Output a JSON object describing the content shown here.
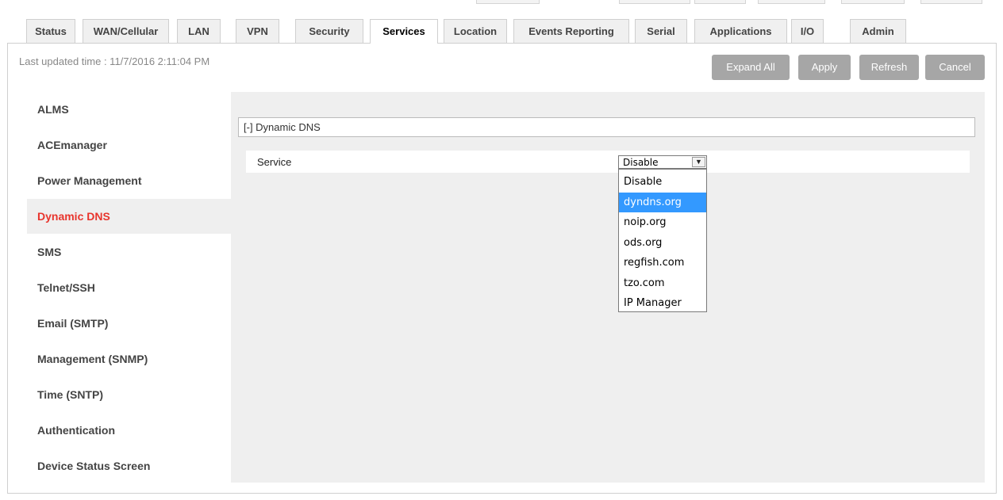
{
  "tabs": [
    {
      "label": "Status"
    },
    {
      "label": "WAN/Cellular"
    },
    {
      "label": "LAN"
    },
    {
      "label": "VPN"
    },
    {
      "label": "Security"
    },
    {
      "label": "Services"
    },
    {
      "label": "Location"
    },
    {
      "label": "Events Reporting"
    },
    {
      "label": "Serial"
    },
    {
      "label": "Applications"
    },
    {
      "label": "I/O"
    },
    {
      "label": "Admin"
    }
  ],
  "active_tab": "Services",
  "last_updated": "Last updated time : 11/7/2016 2:11:04 PM",
  "buttons": {
    "expand_all": "Expand All",
    "apply": "Apply",
    "refresh": "Refresh",
    "cancel": "Cancel"
  },
  "sidebar": {
    "items": [
      {
        "label": "ALMS"
      },
      {
        "label": "ACEmanager"
      },
      {
        "label": "Power Management"
      },
      {
        "label": "Dynamic DNS"
      },
      {
        "label": "SMS"
      },
      {
        "label": "Telnet/SSH"
      },
      {
        "label": "Email (SMTP)"
      },
      {
        "label": "Management (SNMP)"
      },
      {
        "label": "Time (SNTP)"
      },
      {
        "label": "Authentication"
      },
      {
        "label": "Device Status Screen"
      }
    ],
    "active": "Dynamic DNS"
  },
  "section": {
    "header": "[-] Dynamic DNS",
    "service_label": "Service",
    "service_value": "Disable",
    "options": [
      "Disable",
      "dyndns.org",
      "noip.org",
      "ods.org",
      "regfish.com",
      "tzo.com",
      "IP Manager"
    ],
    "highlighted_option": "dyndns.org"
  },
  "colors": {
    "active_sidebar_text": "#e8352d",
    "button_bg": "#a6a6a6",
    "option_highlight": "#3399ff"
  }
}
